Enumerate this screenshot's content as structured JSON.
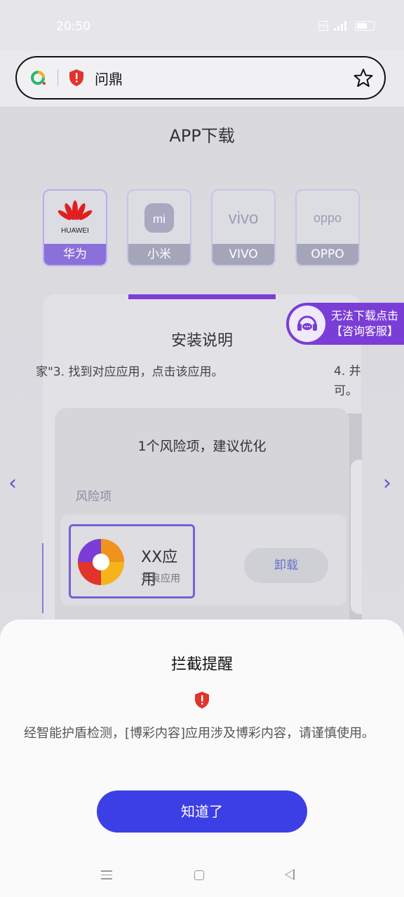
{
  "status_bar": {
    "time": "20:50",
    "network_badge": "HD"
  },
  "address_bar": {
    "url_text": "问鼎",
    "logo_icon": "browser-logo-icon",
    "security_icon": "red-shield-icon",
    "bookmark_icon": "star-icon"
  },
  "page": {
    "heading": "APP下载",
    "brands": [
      {
        "label": "华为",
        "logo_text": "HUAWEI"
      },
      {
        "label": "小米",
        "logo_text": "mi"
      },
      {
        "label": "VIVO",
        "logo_text": "vivo"
      },
      {
        "label": "OPPO",
        "logo_text": "oppo"
      }
    ],
    "install": {
      "title": "安装说明",
      "step3": "家\"3. 找到对应应用，点击该应用。",
      "step4": "4. 并可。"
    },
    "risk": {
      "title": "1个风险项，建议优化",
      "subtitle": "风险项",
      "app_name": "XX应用",
      "app_tag": "不良应用",
      "uninstall_label": "卸载"
    },
    "nav_prev": "‹",
    "nav_next": "›",
    "service": {
      "line1": "无法下载点击",
      "line2": "【咨询客服】"
    }
  },
  "dialog": {
    "title": "拦截提醒",
    "message": "经智能护盾检测，[博彩内容]应用涉及博彩内容，请谨慎使用。",
    "button_label": "知道了"
  },
  "colors": {
    "accent": "#3c3ee6",
    "purple": "#7a3ed6",
    "shield_red": "#e0342c"
  }
}
